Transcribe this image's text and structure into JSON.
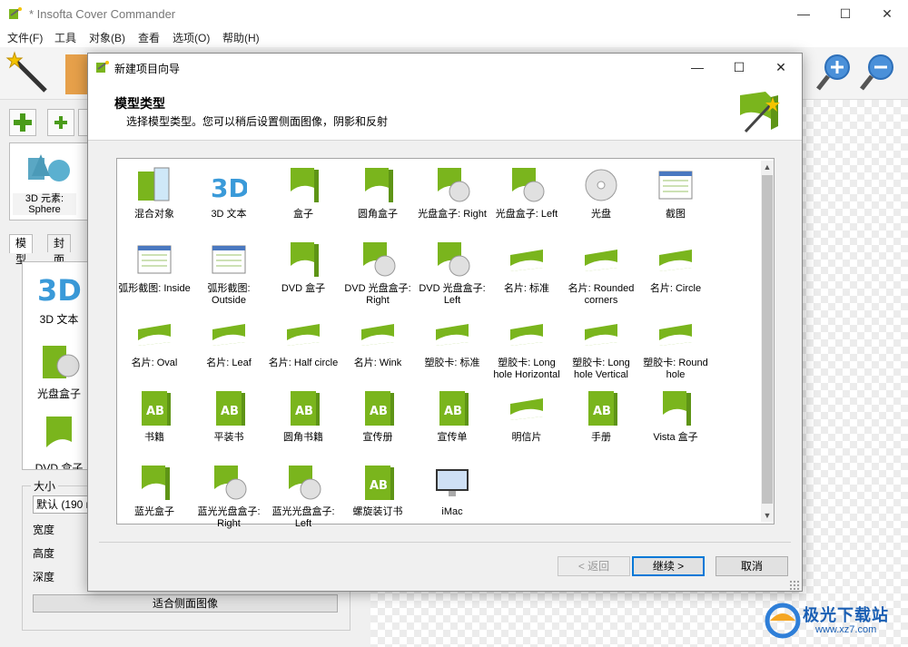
{
  "app": {
    "title": "* Insofta Cover Commander",
    "menu": [
      "文件(F)",
      "工具",
      "对象(B)",
      "查看",
      "选项(O)",
      "帮助(H)"
    ],
    "window_controls": {
      "minimize": "—",
      "maximize": "☐",
      "close": "✕"
    }
  },
  "left_panel": {
    "element_label": "3D 元素:\nSphere",
    "tabs": [
      "模型",
      "封面"
    ],
    "model_list": [
      "3D 文本",
      "光盘盒子",
      "DVD 盒子"
    ],
    "size": {
      "legend": "大小",
      "selected": "默认 (190 m",
      "width_label": "宽度",
      "height_label": "高度",
      "depth_label": "深度",
      "fit_button": "适合侧面图像"
    }
  },
  "dialog": {
    "title": "新建项目向导",
    "heading": "模型类型",
    "subtitle": "选择模型类型。您可以稍后设置侧面图像，阴影和反射",
    "items": [
      {
        "label": "混合对象",
        "icon": "mixed-objects-icon"
      },
      {
        "label": "3D 文本",
        "icon": "3d-text-icon"
      },
      {
        "label": "盒子",
        "icon": "box-icon"
      },
      {
        "label": "圆角盒子",
        "icon": "rounded-box-icon"
      },
      {
        "label": "光盘盒子: Right",
        "icon": "cd-box-right-icon"
      },
      {
        "label": "光盘盒子: Left",
        "icon": "cd-box-left-icon"
      },
      {
        "label": "光盘",
        "icon": "cd-icon"
      },
      {
        "label": "截图",
        "icon": "screenshot-icon"
      },
      {
        "label": "弧形截图: Inside",
        "icon": "arc-screenshot-inside-icon"
      },
      {
        "label": "弧形截图: Outside",
        "icon": "arc-screenshot-outside-icon"
      },
      {
        "label": "DVD 盒子",
        "icon": "dvd-box-icon"
      },
      {
        "label": "DVD 光盘盒子: Right",
        "icon": "dvd-cd-box-right-icon"
      },
      {
        "label": "DVD 光盘盒子: Left",
        "icon": "dvd-cd-box-left-icon"
      },
      {
        "label": "名片: 标准",
        "icon": "card-standard-icon"
      },
      {
        "label": "名片: Rounded corners",
        "icon": "card-rounded-icon"
      },
      {
        "label": "名片: Circle",
        "icon": "card-circle-icon"
      },
      {
        "label": "名片: Oval",
        "icon": "card-oval-icon"
      },
      {
        "label": "名片: Leaf",
        "icon": "card-leaf-icon"
      },
      {
        "label": "名片: Half circle",
        "icon": "card-half-circle-icon"
      },
      {
        "label": "名片: Wink",
        "icon": "card-wink-icon"
      },
      {
        "label": "塑胶卡: 标准",
        "icon": "plastic-card-standard-icon"
      },
      {
        "label": "塑胶卡: Long hole Horizontal",
        "icon": "plastic-card-horizontal-icon"
      },
      {
        "label": "塑胶卡: Long hole Vertical",
        "icon": "plastic-card-vertical-icon"
      },
      {
        "label": "塑胶卡: Round hole",
        "icon": "plastic-card-round-icon"
      },
      {
        "label": "书籍",
        "icon": "book-icon"
      },
      {
        "label": "平装书",
        "icon": "paperback-icon"
      },
      {
        "label": "圆角书籍",
        "icon": "rounded-book-icon"
      },
      {
        "label": "宣传册",
        "icon": "brochure-icon"
      },
      {
        "label": "宣传单",
        "icon": "flyer-icon"
      },
      {
        "label": "明信片",
        "icon": "postcard-icon"
      },
      {
        "label": "手册",
        "icon": "manual-icon"
      },
      {
        "label": "Vista 盒子",
        "icon": "vista-box-icon"
      },
      {
        "label": "蓝光盒子",
        "icon": "bluray-box-icon"
      },
      {
        "label": "蓝光光盘盒子: Right",
        "icon": "bluray-cd-right-icon"
      },
      {
        "label": "蓝光光盘盒子: Left",
        "icon": "bluray-cd-left-icon"
      },
      {
        "label": "螺旋装订书",
        "icon": "spiral-book-icon"
      },
      {
        "label": "iMac",
        "icon": "imac-icon"
      }
    ],
    "buttons": {
      "back": "< 返回",
      "next": "继续 >",
      "cancel": "取消"
    }
  },
  "watermark": {
    "text": "极光下载站",
    "url": "www.xz7.com"
  },
  "colors": {
    "accent_green": "#7ab51d",
    "focus_blue": "#0078d7"
  }
}
